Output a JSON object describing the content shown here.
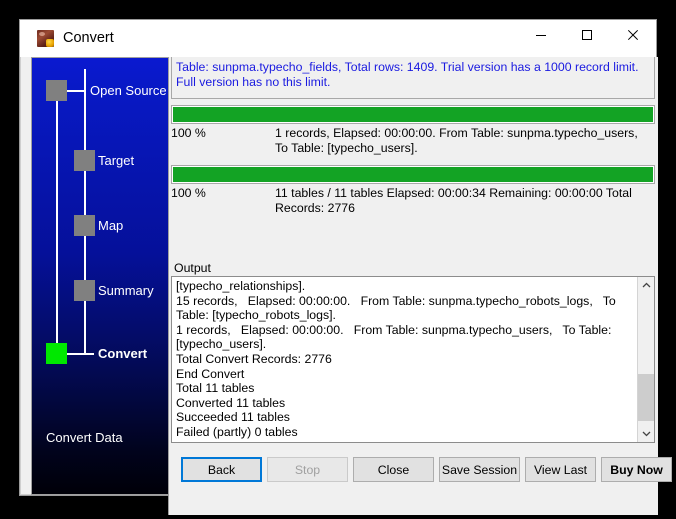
{
  "window": {
    "title": "Convert",
    "icon": "app-icon",
    "controls": {
      "minimize": "minimize-icon",
      "maximize": "maximize-icon",
      "close": "close-icon"
    }
  },
  "sidebar": {
    "footer_label": "Convert Data",
    "steps": [
      {
        "label": "Open Source",
        "state": "done"
      },
      {
        "label": "Target",
        "state": "done"
      },
      {
        "label": "Map",
        "state": "done"
      },
      {
        "label": "Summary",
        "state": "done"
      },
      {
        "label": "Convert",
        "state": "active"
      }
    ],
    "node_color_done": "#808080",
    "node_color_active": "#00e800"
  },
  "content": {
    "notice": "Table: sunpma.typecho_fields, Total rows: 1409. Trial version has a 1000 record limit. Full version has no this limit.",
    "progress": [
      {
        "name": "table-progress",
        "percent_label": "100 %",
        "percent_value": 100,
        "detail": "1 records,   Elapsed: 00:00:00.   From Table: sunpma.typecho_users,  To Table: [typecho_users]."
      },
      {
        "name": "overall-progress",
        "percent_label": "100 %",
        "percent_value": 100,
        "detail": "11 tables / 11 tables   Elapsed: 00:00:34   Remaining: 00:00:00   Total Records: 2776"
      }
    ],
    "progress_fill_color": "#13a324",
    "output_label": "Output",
    "output_text": "[typecho_relationships].\n15 records,   Elapsed: 00:00:00.   From Table: sunpma.typecho_robots_logs,   To Table: [typecho_robots_logs].\n1 records,   Elapsed: 00:00:00.   From Table: sunpma.typecho_users,   To Table: [typecho_users].\nTotal Convert Records: 2776\nEnd Convert\nTotal 11 tables\nConverted 11 tables\nSucceeded 11 tables\nFailed (partly) 0 tables",
    "scrollbar": {
      "up_icon": "chevron-up-icon",
      "down_icon": "chevron-down-icon"
    }
  },
  "buttons": [
    {
      "name": "back-button",
      "label": "Back",
      "style": "default"
    },
    {
      "name": "stop-button",
      "label": "Stop",
      "style": "disabled"
    },
    {
      "name": "close-button",
      "label": "Close",
      "style": "normal"
    },
    {
      "name": "save-session-button",
      "label": "Save Session",
      "style": "normal"
    },
    {
      "name": "view-last-button",
      "label": "View Last",
      "style": "normal"
    },
    {
      "name": "buy-now-button",
      "label": "Buy Now",
      "style": "strong"
    }
  ]
}
